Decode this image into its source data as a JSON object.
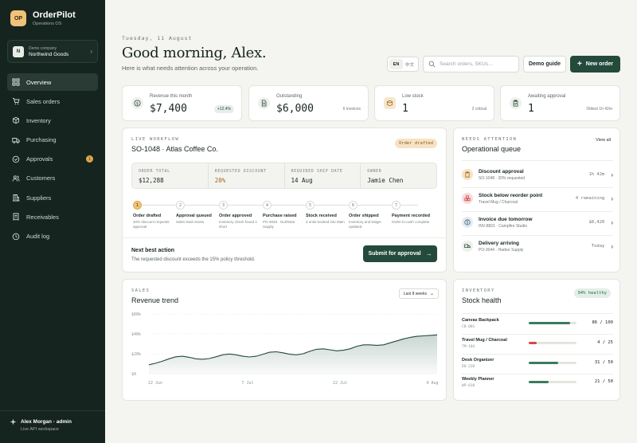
{
  "brand": {
    "logo": "OP",
    "name": "OrderPilot",
    "sub": "Operations OS"
  },
  "company": {
    "badge": "N",
    "label": "Demo company",
    "name": "Northwind Goods"
  },
  "nav": [
    {
      "label": "Overview",
      "icon": "grid-icon",
      "active": true
    },
    {
      "label": "Sales orders",
      "icon": "cart-icon"
    },
    {
      "label": "Inventory",
      "icon": "box-icon"
    },
    {
      "label": "Purchasing",
      "icon": "truck-icon"
    },
    {
      "label": "Approvals",
      "icon": "check-icon",
      "badge": "1"
    },
    {
      "label": "Customers",
      "icon": "users-icon"
    },
    {
      "label": "Suppliers",
      "icon": "building-icon"
    },
    {
      "label": "Receivables",
      "icon": "receipt-icon"
    },
    {
      "label": "Audit log",
      "icon": "clock-icon"
    }
  ],
  "footer": {
    "user": "Alex Morgan · admin",
    "sub": "Live API workspace"
  },
  "header": {
    "date": "Tuesday, 11 August",
    "greeting": "Good morning, Alex.",
    "subtitle": "Here is what needs attention across your operation.",
    "lang_en": "EN",
    "lang_zh": "中文",
    "search_placeholder": "Search orders, SKUs…",
    "guide": "Demo guide",
    "new_order": "New order"
  },
  "kpis": [
    {
      "label": "Revenue this month",
      "value": "$7,400",
      "note": "+12.4%",
      "icon": "dollar-icon"
    },
    {
      "label": "Outstanding",
      "value": "$6,000",
      "note": "6 invoices",
      "icon": "document-icon"
    },
    {
      "label": "Low stock",
      "value": "1",
      "note": "2 critical",
      "icon": "box-icon"
    },
    {
      "label": "Awaiting approval",
      "value": "1",
      "note": "Oldest 1h 42m",
      "icon": "clipboard-icon"
    }
  ],
  "workflow": {
    "eyebrow": "Live workflow",
    "title": "SO-1048 · Atlas Coffee Co.",
    "status": "Order drafted",
    "fields": [
      {
        "k": "Order total",
        "v": "$12,288"
      },
      {
        "k": "Requested discount",
        "v": "20%"
      },
      {
        "k": "Required ship date",
        "v": "14 Aug"
      },
      {
        "k": "Owner",
        "v": "Jamie Chen"
      }
    ],
    "steps": [
      {
        "n": "1",
        "t": "Order drafted",
        "d": "20% discount requests approval"
      },
      {
        "n": "2",
        "t": "Approval queued",
        "d": "Sales lead review"
      },
      {
        "n": "3",
        "t": "Order approved",
        "d": "Inventory check found 4 short"
      },
      {
        "n": "4",
        "t": "Purchase raised",
        "d": "PO-3048 · Northstar Supply"
      },
      {
        "n": "5",
        "t": "Stock received",
        "d": "4 units booked into Main"
      },
      {
        "n": "6",
        "t": "Order shipped",
        "d": "Inventory and ledger updated"
      },
      {
        "n": "7",
        "t": "Payment recorded",
        "d": "Order-to-cash complete"
      }
    ],
    "nba_title": "Next best action",
    "nba_desc": "The requested discount exceeds the 15% policy threshold.",
    "submit": "Submit for approval"
  },
  "queue": {
    "eyebrow": "Needs attention",
    "title": "Operational queue",
    "view_all": "View all",
    "items": [
      {
        "t": "Discount approval",
        "d": "SO-1048 · 20% requested",
        "r": "1h 42m",
        "icon": "clipboard-icon",
        "color": "#f6e3c4"
      },
      {
        "t": "Stock below reorder point",
        "d": "Travel Mug / Charcoal",
        "r": "4 remaining",
        "icon": "boxes-icon",
        "color": "#f7dcdc"
      },
      {
        "t": "Invoice due tomorrow",
        "d": "INV-8831 · Campfire Studio",
        "r": "$8,420",
        "icon": "dollar-icon",
        "color": "#e4ecf2"
      },
      {
        "t": "Delivery arriving",
        "d": "PO-3044 · Harbor Supply",
        "r": "Today",
        "icon": "truck-icon",
        "color": "#eef0eb"
      }
    ]
  },
  "trend": {
    "eyebrow": "Sales",
    "title": "Revenue trend",
    "range": "Last 8 weeks"
  },
  "chart_data": {
    "type": "area",
    "title": "Revenue trend",
    "range_label": "Last 8 weeks",
    "x_ticks": [
      "22 Jun",
      "7 Jul",
      "22 Jul",
      "4 Aug"
    ],
    "y_ticks": [
      "$60k",
      "$40k",
      "$20k",
      "$0"
    ],
    "ylim": [
      0,
      60000
    ],
    "x": [
      0,
      1,
      2,
      3,
      4,
      5,
      6,
      7,
      8,
      9,
      10,
      11,
      12,
      13,
      14,
      15,
      16,
      17,
      18,
      19,
      20,
      21,
      22,
      23,
      24,
      25,
      26,
      27,
      28,
      29,
      30,
      31,
      32,
      33,
      34,
      35,
      36,
      37,
      38,
      39,
      40,
      41,
      42,
      43
    ],
    "values": [
      9000,
      10500,
      12500,
      15000,
      17000,
      17500,
      16500,
      15000,
      14500,
      15200,
      17000,
      19000,
      19800,
      19000,
      17500,
      16800,
      17500,
      19500,
      21500,
      22000,
      21000,
      19500,
      19000,
      20000,
      22500,
      24500,
      25000,
      24000,
      23000,
      23500,
      25000,
      27500,
      29000,
      29000,
      28500,
      29000,
      31000,
      33000,
      35000,
      36500,
      37500,
      38000,
      38500,
      39000
    ],
    "grid": true
  },
  "stock": {
    "eyebrow": "Inventory",
    "title": "Stock health",
    "badge": "94% healthy",
    "items": [
      {
        "name": "Canvas Backpack",
        "sku": "CB-001",
        "val": "86 / 100",
        "pct": 0.86,
        "color": "#3d7a5e"
      },
      {
        "name": "Travel Mug / Charcoal",
        "sku": "TM-104",
        "val": "4 / 25",
        "pct": 0.16,
        "color": "#d24a44"
      },
      {
        "name": "Desk Organizer",
        "sku": "DO-220",
        "val": "31 / 50",
        "pct": 0.62,
        "color": "#3d7a5e"
      },
      {
        "name": "Weekly Planner",
        "sku": "WP-010",
        "val": "21 / 50",
        "pct": 0.42,
        "color": "#3d7a5e"
      }
    ]
  }
}
